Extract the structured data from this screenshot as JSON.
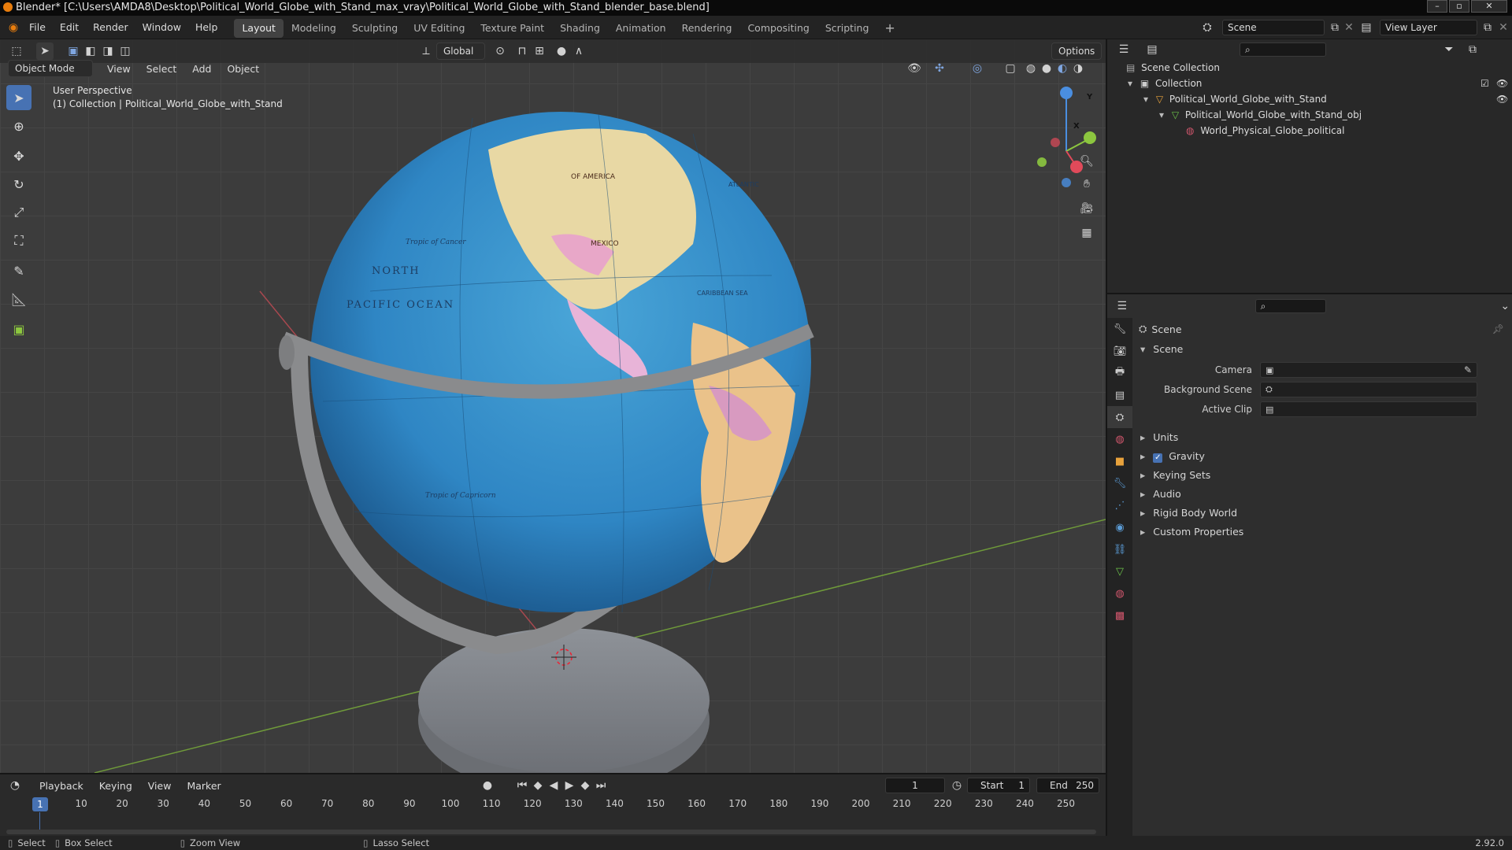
{
  "titlebar": {
    "title": "Blender* [C:\\Users\\AMDA8\\Desktop\\Political_World_Globe_with_Stand_max_vray\\Political_World_Globe_with_Stand_blender_base.blend]"
  },
  "menu": {
    "file": "File",
    "edit": "Edit",
    "render": "Render",
    "window": "Window",
    "help": "Help"
  },
  "workspaces": [
    "Layout",
    "Modeling",
    "Sculpting",
    "UV Editing",
    "Texture Paint",
    "Shading",
    "Animation",
    "Rendering",
    "Compositing",
    "Scripting"
  ],
  "active_workspace": "Layout",
  "scene_selector": {
    "value": "Scene"
  },
  "view_layer": {
    "value": "View Layer"
  },
  "viewport": {
    "transform_orientation": "Global",
    "options_label": "Options",
    "mode": "Object Mode",
    "menus": {
      "view": "View",
      "select": "Select",
      "add": "Add",
      "object": "Object"
    },
    "overlay_title": "User Perspective",
    "overlay_subtitle": "(1) Collection | Political_World_Globe_with_Stand",
    "gizmo": {
      "z": "Z",
      "y": "Y",
      "x": "X"
    }
  },
  "outliner": {
    "scene_collection": "Scene Collection",
    "collection": "Collection",
    "object": "Political_World_Globe_with_Stand",
    "mesh": "Political_World_Globe_with_Stand_obj",
    "material": "World_Physical_Globe_political"
  },
  "properties": {
    "header": "Scene",
    "section": "Scene",
    "camera_label": "Camera",
    "background_scene_label": "Background Scene",
    "active_clip_label": "Active Clip",
    "panels": {
      "units": "Units",
      "gravity": "Gravity",
      "keying_sets": "Keying Sets",
      "audio": "Audio",
      "rigid_body_world": "Rigid Body World",
      "custom_properties": "Custom Properties"
    },
    "gravity_checked": true
  },
  "timeline": {
    "menus": {
      "playback": "Playback",
      "keying": "Keying",
      "view": "View",
      "marker": "Marker"
    },
    "current_frame": "1",
    "start_label": "Start",
    "start_value": "1",
    "end_label": "End",
    "end_value": "250",
    "ticks": [
      "10",
      "20",
      "30",
      "40",
      "50",
      "60",
      "70",
      "80",
      "90",
      "100",
      "110",
      "120",
      "130",
      "140",
      "150",
      "160",
      "170",
      "180",
      "190",
      "200",
      "210",
      "220",
      "230",
      "240",
      "250"
    ],
    "playhead_label": "1"
  },
  "status": {
    "select": "Select",
    "box_select": "Box Select",
    "zoom_view": "Zoom View",
    "lasso_select": "Lasso Select",
    "version": "2.92.0"
  },
  "globe_labels": {
    "north": "NORTH",
    "pacific": "PACIFIC OCEAN",
    "cancer": "Tropic of Cancer",
    "capricorn": "Tropic of Capricorn",
    "mexico": "MEXICO",
    "america": "OF AMERICA",
    "caribbean": "CARIBBEAN SEA",
    "atlantic": "ATLANTIC"
  },
  "colors": {
    "accent": "#4772b3",
    "active_tab": "#424242",
    "axis_x": "#e04a5a",
    "axis_y": "#8cc63f",
    "axis_z": "#4a8ee0"
  }
}
